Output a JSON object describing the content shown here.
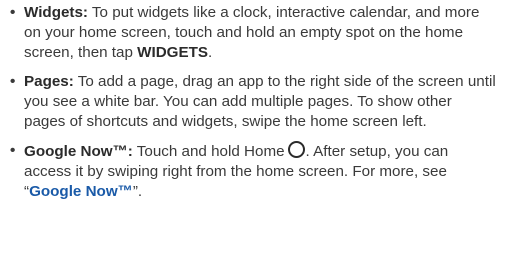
{
  "items": [
    {
      "bullet": "•",
      "term": "Widgets:",
      "text_before": " To put widgets like a clock, interactive calendar, and more on your home screen, touch and hold an empty spot on the home screen, then tap ",
      "ui_word": "WIDGETS",
      "text_after": "."
    },
    {
      "bullet": "•",
      "term": "Pages:",
      "text": " To add a page, drag an app to the right side of the screen until you see a white bar. You can add multiple pages. To show other pages of shortcuts and widgets, swipe the home screen left."
    },
    {
      "bullet": "•",
      "term": "Google Now™:",
      "text_before_icon": " Touch and hold Home",
      "icon": "home-circle-icon",
      "text_after_icon": ". After setup, you can access it by swiping right from the home screen. For more, see “",
      "link_label": "Google Now™",
      "text_end": "”."
    }
  ],
  "colors": {
    "body_text": "#3a3a3a",
    "link": "#1a5aa8"
  }
}
